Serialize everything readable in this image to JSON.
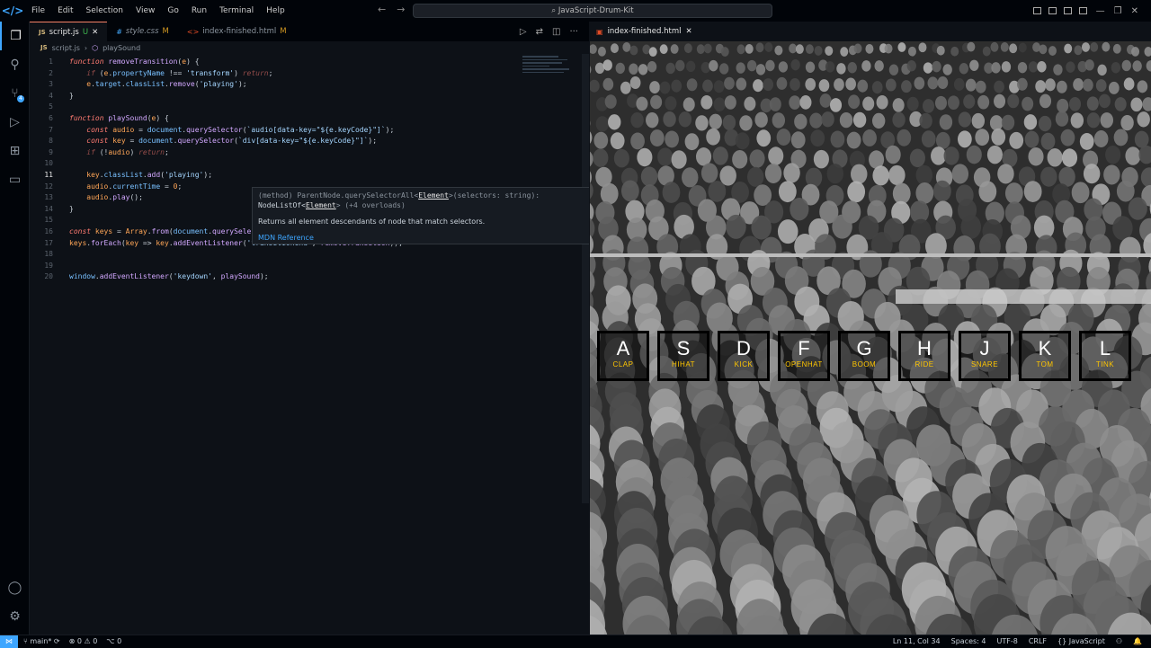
{
  "menu": [
    "File",
    "Edit",
    "Selection",
    "View",
    "Go",
    "Run",
    "Terminal",
    "Help"
  ],
  "search_text": "JavaScript-Drum-Kit",
  "tabs": [
    {
      "name": "script.js",
      "status": "U",
      "icon": "JS"
    },
    {
      "name": "style.css",
      "status": "M",
      "icon": "#"
    },
    {
      "name": "index-finished.html",
      "status": "M",
      "icon": "<>"
    }
  ],
  "breadcrumb": {
    "file": "script.js",
    "symbol": "playSound"
  },
  "code_lines": [
    {
      "n": "1",
      "html": "<span class='kw'>function</span> <span class='fn'>removeTransition</span>(<span class='var'>e</span>) {"
    },
    {
      "n": "2",
      "html": "    <span class='kw fade'>if</span> (<span class='var'>e</span>.<span class='prop'>propertyName</span> !== <span class='str'>'transform'</span>) <span class='kw fade'>return</span>;"
    },
    {
      "n": "3",
      "html": "    <span class='var'>e</span>.<span class='prop'>target</span>.<span class='prop'>classList</span>.<span class='fn'>remove</span>(<span class='str'>'playing'</span>);"
    },
    {
      "n": "4",
      "html": "}"
    },
    {
      "n": "5",
      "html": ""
    },
    {
      "n": "6",
      "html": "<span class='kw'>function</span> <span class='fn'>playSound</span>(<span class='var'>e</span>) {"
    },
    {
      "n": "7",
      "html": "    <span class='kw'>const</span> <span class='var'>audio</span> = <span class='prop'>document</span>.<span class='fn'>querySelector</span>(<span class='str'>`audio[data-key=\"${e.keyCode}\"]`</span>);"
    },
    {
      "n": "8",
      "html": "    <span class='kw'>const</span> <span class='var'>key</span> = <span class='prop'>document</span>.<span class='fn'>querySelector</span>(<span class='str'>`div[data-key=\"${e.keyCode}\"]`</span>);"
    },
    {
      "n": "9",
      "html": "    <span class='kw fade'>if</span> (!<span class='var'>audio</span>) <span class='kw fade'>return</span>;"
    },
    {
      "n": "10",
      "html": ""
    },
    {
      "n": "11",
      "html": "    <span class='var'>key</span>.<span class='prop'>classList</span>.<span class='fn'>add</span>(<span class='str'>'playing'</span>);"
    },
    {
      "n": "12",
      "html": "    <span class='var'>audio</span>.<span class='prop'>currentTime</span> = <span class='var'>0</span>;"
    },
    {
      "n": "13",
      "html": "    <span class='var'>audio</span>.<span class='fn'>play</span>();"
    },
    {
      "n": "14",
      "html": "}"
    },
    {
      "n": "15",
      "html": ""
    },
    {
      "n": "16",
      "html": "<span class='kw'>const</span> <span class='var'>keys</span> = <span class='var'>Array</span>.<span class='fn'>from</span>(<span class='prop'>document</span>.<span class='fn'>querySelectorAll</span>(<span class='str'>'.key'</span>));"
    },
    {
      "n": "17",
      "html": "<span class='var'>keys</span>.<span class='fn'>forEach</span>(<span class='var'>key</span> =&gt; <span class='var'>key</span>.<span class='fn'>addEventListener</span>(<span class='str'>'transitionend'</span>, <span class='fn'>removeTransition</span>));"
    },
    {
      "n": "18",
      "html": ""
    },
    {
      "n": "19",
      "html": ""
    },
    {
      "n": "20",
      "html": "<span class='prop'>window</span>.<span class='fn'>addEventListener</span>(<span class='str'>'keydown'</span>, <span class='fn'>playSound</span>);"
    }
  ],
  "tooltip": {
    "sig_prefix": "(method) ParentNode.querySelectorAll<",
    "sig_em": "Element",
    "sig_suffix": ">(selectors: string):",
    "ret_prefix": "NodeListOf<",
    "ret_em": "Element",
    "ret_suffix": "> (+4 overloads)",
    "desc": "Returns all element descendants of node that match selectors.",
    "link": "MDN Reference"
  },
  "preview_tab": "index-finished.html",
  "drum_keys": [
    {
      "k": "A",
      "s": "CLAP"
    },
    {
      "k": "S",
      "s": "HIHAT"
    },
    {
      "k": "D",
      "s": "KICK"
    },
    {
      "k": "F",
      "s": "OPENHAT"
    },
    {
      "k": "G",
      "s": "BOOM"
    },
    {
      "k": "H",
      "s": "RIDE"
    },
    {
      "k": "J",
      "s": "SNARE"
    },
    {
      "k": "K",
      "s": "TOM"
    },
    {
      "k": "L",
      "s": "TINK"
    }
  ],
  "status": {
    "branch": "main*",
    "errors": "0",
    "warnings": "0",
    "ports": "0",
    "position": "Ln 11, Col 34",
    "spaces": "Spaces: 4",
    "encoding": "UTF-8",
    "eol": "CRLF",
    "language": "JavaScript"
  },
  "colors": {
    "accent": "#3ea6ff",
    "key_label": "#ffc600"
  }
}
